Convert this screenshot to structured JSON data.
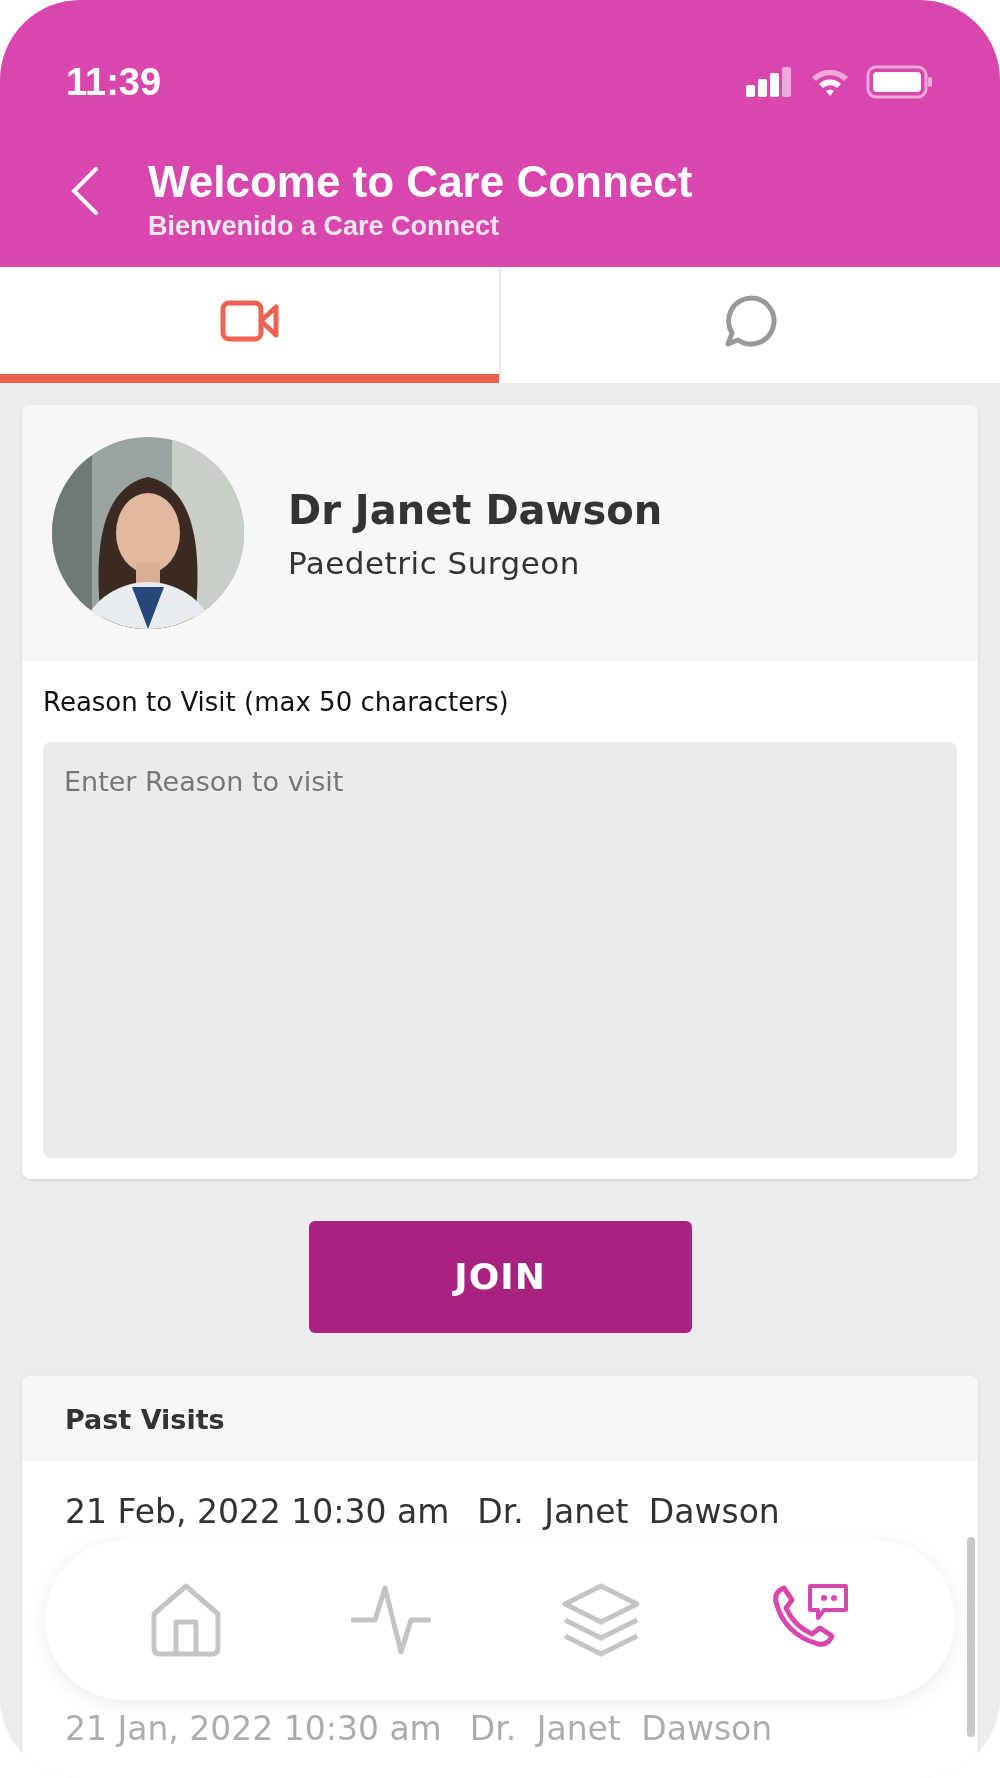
{
  "status_bar": {
    "time": "11:39"
  },
  "header": {
    "title": "Welcome to Care Connect",
    "subtitle": "Bienvenido a Care Connect"
  },
  "tabs": [
    {
      "kind": "video",
      "selected": true
    },
    {
      "kind": "chat",
      "selected": false
    }
  ],
  "doctor": {
    "name": "Dr Janet Dawson",
    "specialty": "Paedetric Surgeon"
  },
  "reason": {
    "label": "Reason to Visit (max 50 characters)",
    "placeholder": "Enter Reason to visit"
  },
  "join_button": "JOIN",
  "past_visits": {
    "title": "Past Visits",
    "rows": [
      {
        "date": "21 Feb, 2022 10:30 am",
        "doctor": "Dr. Janet Dawson",
        "faded": false
      },
      {
        "date": "21 Jan, 2022 10:30 am",
        "doctor": "Dr. Janet Dawson",
        "faded": true
      }
    ]
  },
  "bottom_nav": [
    {
      "kind": "home",
      "selected": false
    },
    {
      "kind": "activity",
      "selected": false
    },
    {
      "kind": "layers",
      "selected": false
    },
    {
      "kind": "call",
      "selected": true
    }
  ]
}
